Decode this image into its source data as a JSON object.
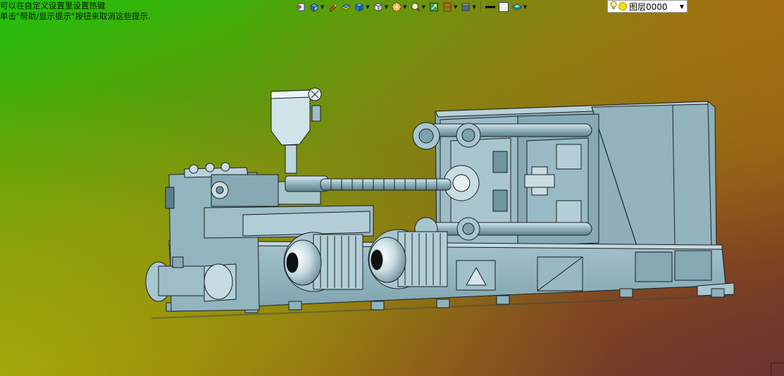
{
  "status_hints": {
    "line1": "可以在自定义设置里设置热键",
    "line2": "单击\"帮助/显示提示\"按钮来取消这些提示."
  },
  "toolbar": {
    "buttons": [
      {
        "icon": "exit-icon",
        "dropdown": false
      },
      {
        "icon": "view-orient-icon",
        "dropdown": true
      },
      {
        "icon": "pen-icon",
        "dropdown": false
      },
      {
        "icon": "materials-icon",
        "dropdown": false
      },
      {
        "icon": "cube-view-icon",
        "dropdown": true
      },
      {
        "icon": "white-cube-icon",
        "dropdown": true
      },
      {
        "icon": "render-ball-icon",
        "dropdown": true
      },
      {
        "icon": "zoom-icon",
        "dropdown": true
      },
      {
        "icon": "fit-icon",
        "dropdown": false
      },
      {
        "icon": "section-icon",
        "dropdown": true
      },
      {
        "icon": "shading-icon",
        "dropdown": true
      },
      {
        "icon": "line-color-icon",
        "dropdown": false
      },
      {
        "icon": "fill-color-icon",
        "dropdown": false
      },
      {
        "icon": "layers-icon",
        "dropdown": true
      }
    ]
  },
  "layer_select": {
    "value": "图层0000"
  },
  "colors": {
    "model_fill": "#8fb2bd",
    "model_light": "#b5d1d9",
    "model_dark": "#5c7f8a",
    "edge": "#1a2024"
  }
}
